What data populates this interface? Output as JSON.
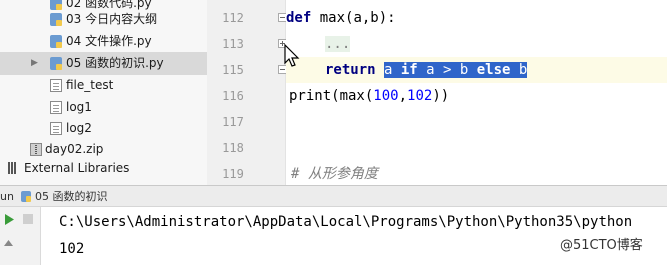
{
  "project_tree": {
    "items": [
      {
        "label": "02 函数代码.py",
        "type": "python"
      },
      {
        "label": "03 今日内容大纲",
        "type": "python"
      },
      {
        "label": "04 文件操作.py",
        "type": "python"
      },
      {
        "label": "05 函数的初识.py",
        "type": "python",
        "selected": true
      },
      {
        "label": "file_test",
        "type": "text"
      },
      {
        "label": "log1",
        "type": "text"
      },
      {
        "label": "log2",
        "type": "text"
      },
      {
        "label": "day02.zip",
        "type": "zip"
      },
      {
        "label": "External Libraries",
        "type": "library"
      }
    ]
  },
  "editor": {
    "line_numbers": [
      "112",
      "113",
      "115",
      "116",
      "117",
      "118",
      "119"
    ],
    "lines": {
      "l112": {
        "kw": "def",
        "rest": " max(a,b):"
      },
      "l113": {
        "folded": "..."
      },
      "l115": {
        "kw": "return",
        "sel_a": "a ",
        "sel_if": "if",
        "sel_mid": " a > b ",
        "sel_else": "else",
        "sel_b": " b"
      },
      "l116": {
        "pre": "print(max(",
        "n1": "100",
        "comma": ",",
        "n2": "102",
        "post": "))"
      },
      "l119": {
        "comment": "# 从形参角度"
      }
    }
  },
  "run_panel": {
    "prefix": "un",
    "tab_label": "05 函数的初识",
    "command": "C:\\Users\\Administrator\\AppData\\Local\\Programs\\Python\\Python35\\python",
    "output": "102"
  },
  "watermark": "@51CTO博客",
  "colors": {
    "selection": "#2f65ca",
    "keyword": "#000080",
    "number": "#0000ff",
    "run_green": "#3a9c3a"
  }
}
